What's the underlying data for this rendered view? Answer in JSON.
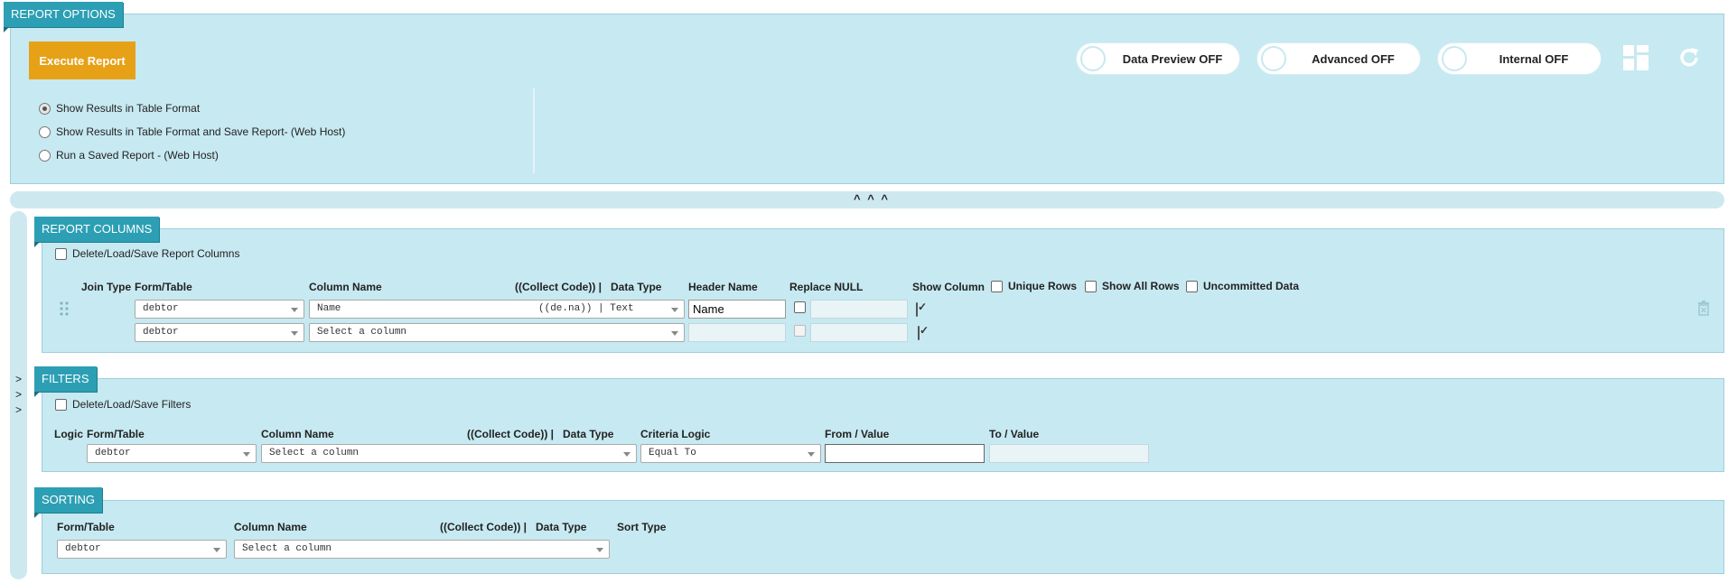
{
  "report_options": {
    "tab_label": "REPORT OPTIONS",
    "execute_label": "Execute Report",
    "toggles": [
      {
        "label": "Data Preview OFF"
      },
      {
        "label": "Advanced OFF"
      },
      {
        "label": "Internal OFF"
      }
    ],
    "radios": [
      {
        "label": "Show Results in Table Format",
        "selected": true
      },
      {
        "label": "Show Results in Table Format and Save Report- (Web Host)",
        "selected": false
      },
      {
        "label": "Run a Saved Report - (Web Host)",
        "selected": false
      }
    ],
    "icons": {
      "grid": "grid-layout-icon",
      "refresh": "refresh-icon"
    }
  },
  "collapse_bar": {
    "label": "^ ^ ^"
  },
  "side_arrows": [
    ">",
    ">",
    ">"
  ],
  "report_columns": {
    "tab_label": "REPORT COLUMNS",
    "delete_load_save": "Delete/Load/Save Report Columns",
    "headers": {
      "join_type": "Join Type",
      "form_table": "Form/Table",
      "column_name": "Column Name",
      "collect_code": "((Collect Code)) |",
      "data_type": "Data Type",
      "header_name": "Header Name",
      "replace_null": "Replace NULL",
      "show_column": "Show Column",
      "unique_rows": "Unique Rows",
      "show_all_rows": "Show All Rows",
      "uncommitted_data": "Uncommitted Data"
    },
    "rows": [
      {
        "form_table": "debtor",
        "column": "Name",
        "column_suffix": "((de.na)) | Text",
        "header_name": "Name",
        "replace_null_checked": false,
        "show_column": true
      },
      {
        "form_table": "debtor",
        "column": "Select a column",
        "column_suffix": "",
        "header_name": "",
        "replace_null_checked": false,
        "show_column": true
      }
    ]
  },
  "filters": {
    "tab_label": "FILTERS",
    "delete_load_save": "Delete/Load/Save Filters",
    "headers": {
      "logic": "Logic",
      "form_table": "Form/Table",
      "column_name": "Column Name",
      "collect_code": "((Collect Code)) |",
      "data_type": "Data Type",
      "criteria_logic": "Criteria Logic",
      "from_value": "From / Value",
      "to_value": "To / Value"
    },
    "row": {
      "form_table": "debtor",
      "column": "Select a column",
      "criteria": "Equal To",
      "from": "",
      "to": ""
    }
  },
  "sorting": {
    "tab_label": "SORTING",
    "headers": {
      "form_table": "Form/Table",
      "column_name": "Column Name",
      "collect_code": "((Collect Code)) |",
      "data_type": "Data Type",
      "sort_type": "Sort Type"
    },
    "row": {
      "form_table": "debtor",
      "column": "Select a column"
    }
  }
}
